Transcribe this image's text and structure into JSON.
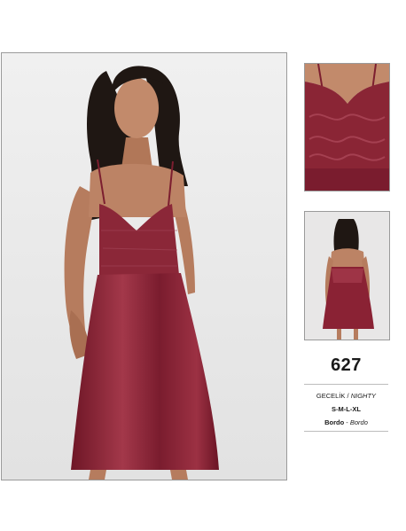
{
  "product": {
    "code": "627",
    "type_tr": "GECELİK",
    "type_sep": "/",
    "type_en": "NIGHTY",
    "sizes": "S-M-L-XL",
    "color_tr": "Bordo",
    "color_sep": "-",
    "color_en": "Bordo"
  },
  "colors": {
    "garment": "#7c1e2f",
    "garment_light": "#a73a4b",
    "background": "#ececec",
    "skin": "#b98062",
    "hair": "#1f1713"
  }
}
